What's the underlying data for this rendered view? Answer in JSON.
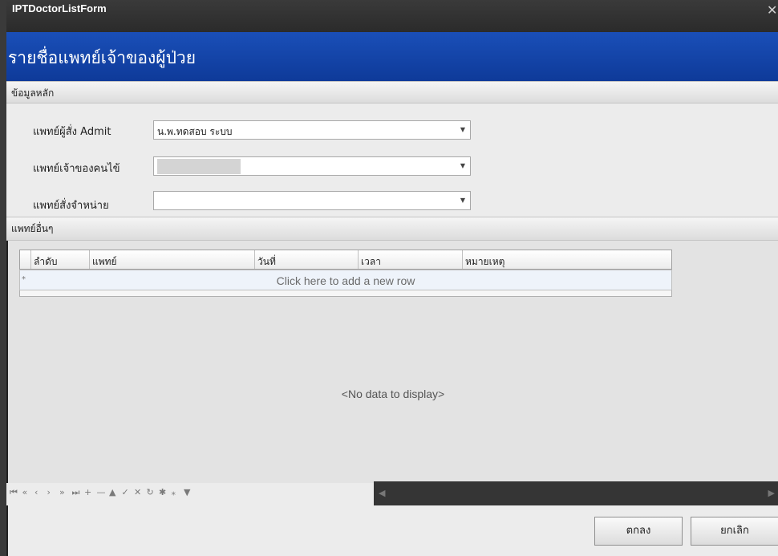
{
  "window": {
    "title": "IPTDoctorListForm",
    "close_glyph": "✕"
  },
  "header": {
    "title": "รายชื่อแพทย์เจ้าของผู้ป่วย"
  },
  "main_section": {
    "label": "ข้อมูลหลัก"
  },
  "fields": [
    {
      "label": "แพทย์ผู้สั่ง Admit",
      "value": "น.พ.ทดสอบ ระบบ"
    },
    {
      "label": "แพทย์เจ้าของคนไข้",
      "value": ""
    },
    {
      "label": "แพทย์สั่งจำหน่าย",
      "value": ""
    }
  ],
  "other_section": {
    "label": "แพทย์อื่นๆ"
  },
  "grid": {
    "columns": [
      "ลำดับ",
      "แพทย์",
      "วันที่",
      "เวลา",
      "หมายเหตุ"
    ],
    "new_row_text": "Click here to add a new row",
    "new_row_marker": "*",
    "empty_text": "<No data to display>"
  },
  "navigator": {
    "icons": [
      "first-page-icon",
      "prev-page-icon",
      "prev-icon",
      "next-icon",
      "next-page-icon",
      "last-page-icon",
      "append-icon",
      "delete-icon",
      "edit-icon",
      "end-edit-icon",
      "cancel-edit-icon",
      "refresh-icon",
      "bookmark-icon",
      "goto-bookmark-icon",
      "filter-icon"
    ],
    "glyphs": [
      "⏮",
      "«",
      "‹",
      "›",
      "»",
      "⏭",
      "+",
      "—",
      "▲",
      "✓",
      "✕",
      "↻",
      "✱",
      "⁎",
      "▼"
    ]
  },
  "buttons": {
    "ok": "ตกลง",
    "cancel": "ยกเลิก"
  }
}
